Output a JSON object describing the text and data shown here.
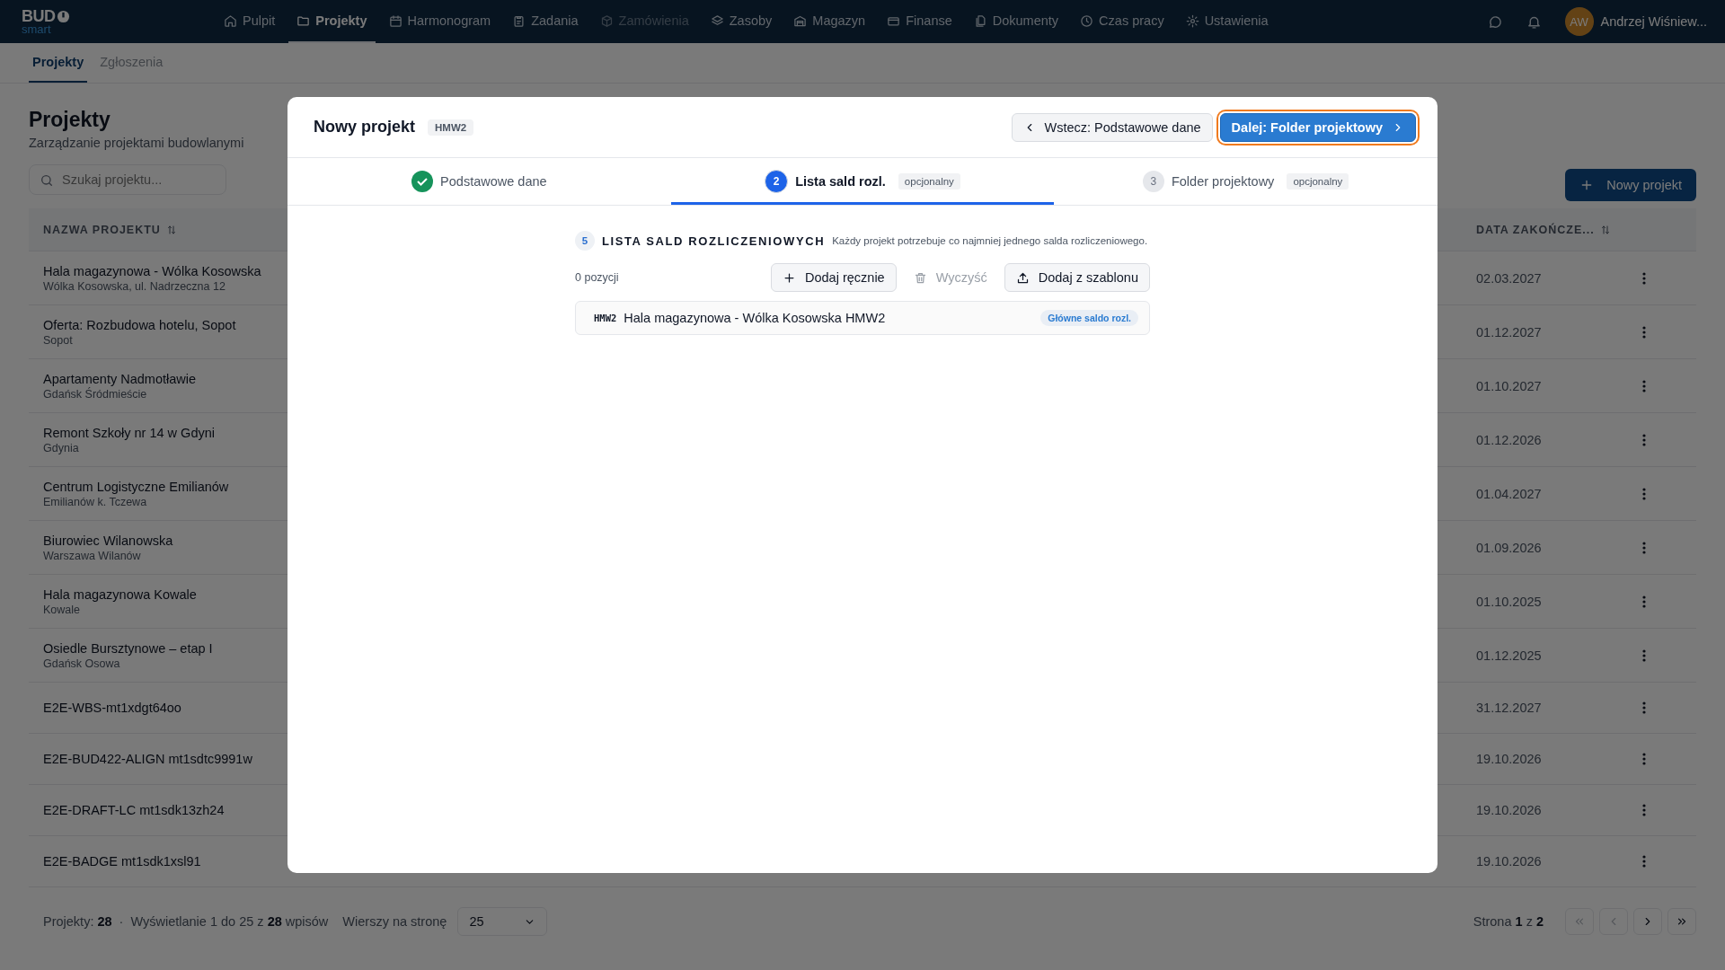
{
  "logo": {
    "text": "BUD",
    "sub": "smart"
  },
  "nav": [
    {
      "label": "Pulpit",
      "selected": false,
      "disabled": false
    },
    {
      "label": "Projekty",
      "selected": true,
      "disabled": false
    },
    {
      "label": "Harmonogram",
      "selected": false,
      "disabled": false
    },
    {
      "label": "Zadania",
      "selected": false,
      "disabled": false
    },
    {
      "label": "Zamówienia",
      "selected": false,
      "disabled": true
    },
    {
      "label": "Zasoby",
      "selected": false,
      "disabled": false
    },
    {
      "label": "Magazyn",
      "selected": false,
      "disabled": false
    },
    {
      "label": "Finanse",
      "selected": false,
      "disabled": false
    },
    {
      "label": "Dokumenty",
      "selected": false,
      "disabled": false
    },
    {
      "label": "Czas pracy",
      "selected": false,
      "disabled": false
    },
    {
      "label": "Ustawienia",
      "selected": false,
      "disabled": false
    }
  ],
  "user": {
    "initials": "AW",
    "name": "Andrzej Wiśniew..."
  },
  "subtabs": [
    {
      "label": "Projekty",
      "selected": true
    },
    {
      "label": "Zgłoszenia",
      "selected": false
    }
  ],
  "page": {
    "title": "Projekty",
    "subtitle": "Zarządzanie projektami budowlanymi",
    "search": {
      "placeholder": "Szukaj projektu..."
    },
    "new_button": "Nowy projekt"
  },
  "table": {
    "columns": {
      "name": "NAZWA PROJEKTU",
      "end_date": "DATA ZAKOŃCZE..."
    },
    "rows": [
      {
        "name": "Hala magazynowa - Wólka Kosowska",
        "location": "Wólka Kosowska, ul. Nadrzeczna 12",
        "end_date": "02.03.2027"
      },
      {
        "name": "Oferta: Rozbudowa hotelu, Sopot",
        "location": "Sopot",
        "end_date": "01.12.2027"
      },
      {
        "name": "Apartamenty Nadmotławie",
        "location": "Gdańsk Śródmieście",
        "end_date": "01.10.2027"
      },
      {
        "name": "Remont Szkoły nr 14 w Gdyni",
        "location": "Gdynia",
        "end_date": "01.12.2026"
      },
      {
        "name": "Centrum Logistyczne Emilianów",
        "location": "Emilianów k. Tczewa",
        "end_date": "01.04.2027"
      },
      {
        "name": "Biurowiec Wilanowska",
        "location": "Warszawa Wilanów",
        "end_date": "01.09.2026"
      },
      {
        "name": "Hala magazynowa Kowale",
        "location": "Kowale",
        "end_date": "01.10.2025"
      },
      {
        "name": "Osiedle Bursztynowe – etap I",
        "location": "Gdańsk Osowa",
        "end_date": "01.12.2025"
      },
      {
        "name": "E2E-WBS-mt1xdgt64oo",
        "end_date": "31.12.2027"
      },
      {
        "name": "E2E-BUD422-ALIGN mt1sdtc9991w",
        "end_date": "19.10.2026"
      },
      {
        "name": "E2E-DRAFT-LC mt1sdk13zh24",
        "end_date": "19.10.2026"
      },
      {
        "name": "E2E-BADGE mt1sdk1xsl91",
        "end_date": "19.10.2026"
      }
    ]
  },
  "footer": {
    "projects_label": "Projekty:",
    "projects_count": "28",
    "separator": "·",
    "showing": "Wyświetlanie 1 do 25 z **28** wpisów",
    "rows_label": "Wierszy na stronę",
    "rows_value": "25",
    "page_text": "Strona **1** z **2**"
  },
  "modal": {
    "title": "Nowy projekt",
    "code": "HMW2",
    "back_button": "Wstecz: Podstawowe dane",
    "next_button": "Dalej: Folder projektowy",
    "steps": [
      {
        "label": "Podstawowe dane",
        "completed": true,
        "selected": false
      },
      {
        "number": "2",
        "label": "Lista sald rozl.",
        "badge": "opcjonalny",
        "completed": false,
        "selected": true
      },
      {
        "number": "3",
        "label": "Folder projektowy",
        "badge": "opcjonalny",
        "completed": false,
        "selected": false
      }
    ],
    "section": {
      "count": "5",
      "title": "LISTA SALD ROZLICZENIOWYCH",
      "hint": "Każdy projekt potrzebuje co najmniej jednego salda rozliczeniowego.",
      "positions": "0 pozycji",
      "actions": [
        {
          "label": "Dodaj ręcznie",
          "disabled": false
        },
        {
          "label": "Wyczyść",
          "disabled": true
        },
        {
          "label": "Dodaj z szablonu",
          "disabled": false
        }
      ],
      "items": [
        {
          "code": "HMW2",
          "name": "Hala magazynowa - Wólka Kosowska HMW2",
          "badge": "Główne saldo rozl."
        }
      ]
    }
  }
}
